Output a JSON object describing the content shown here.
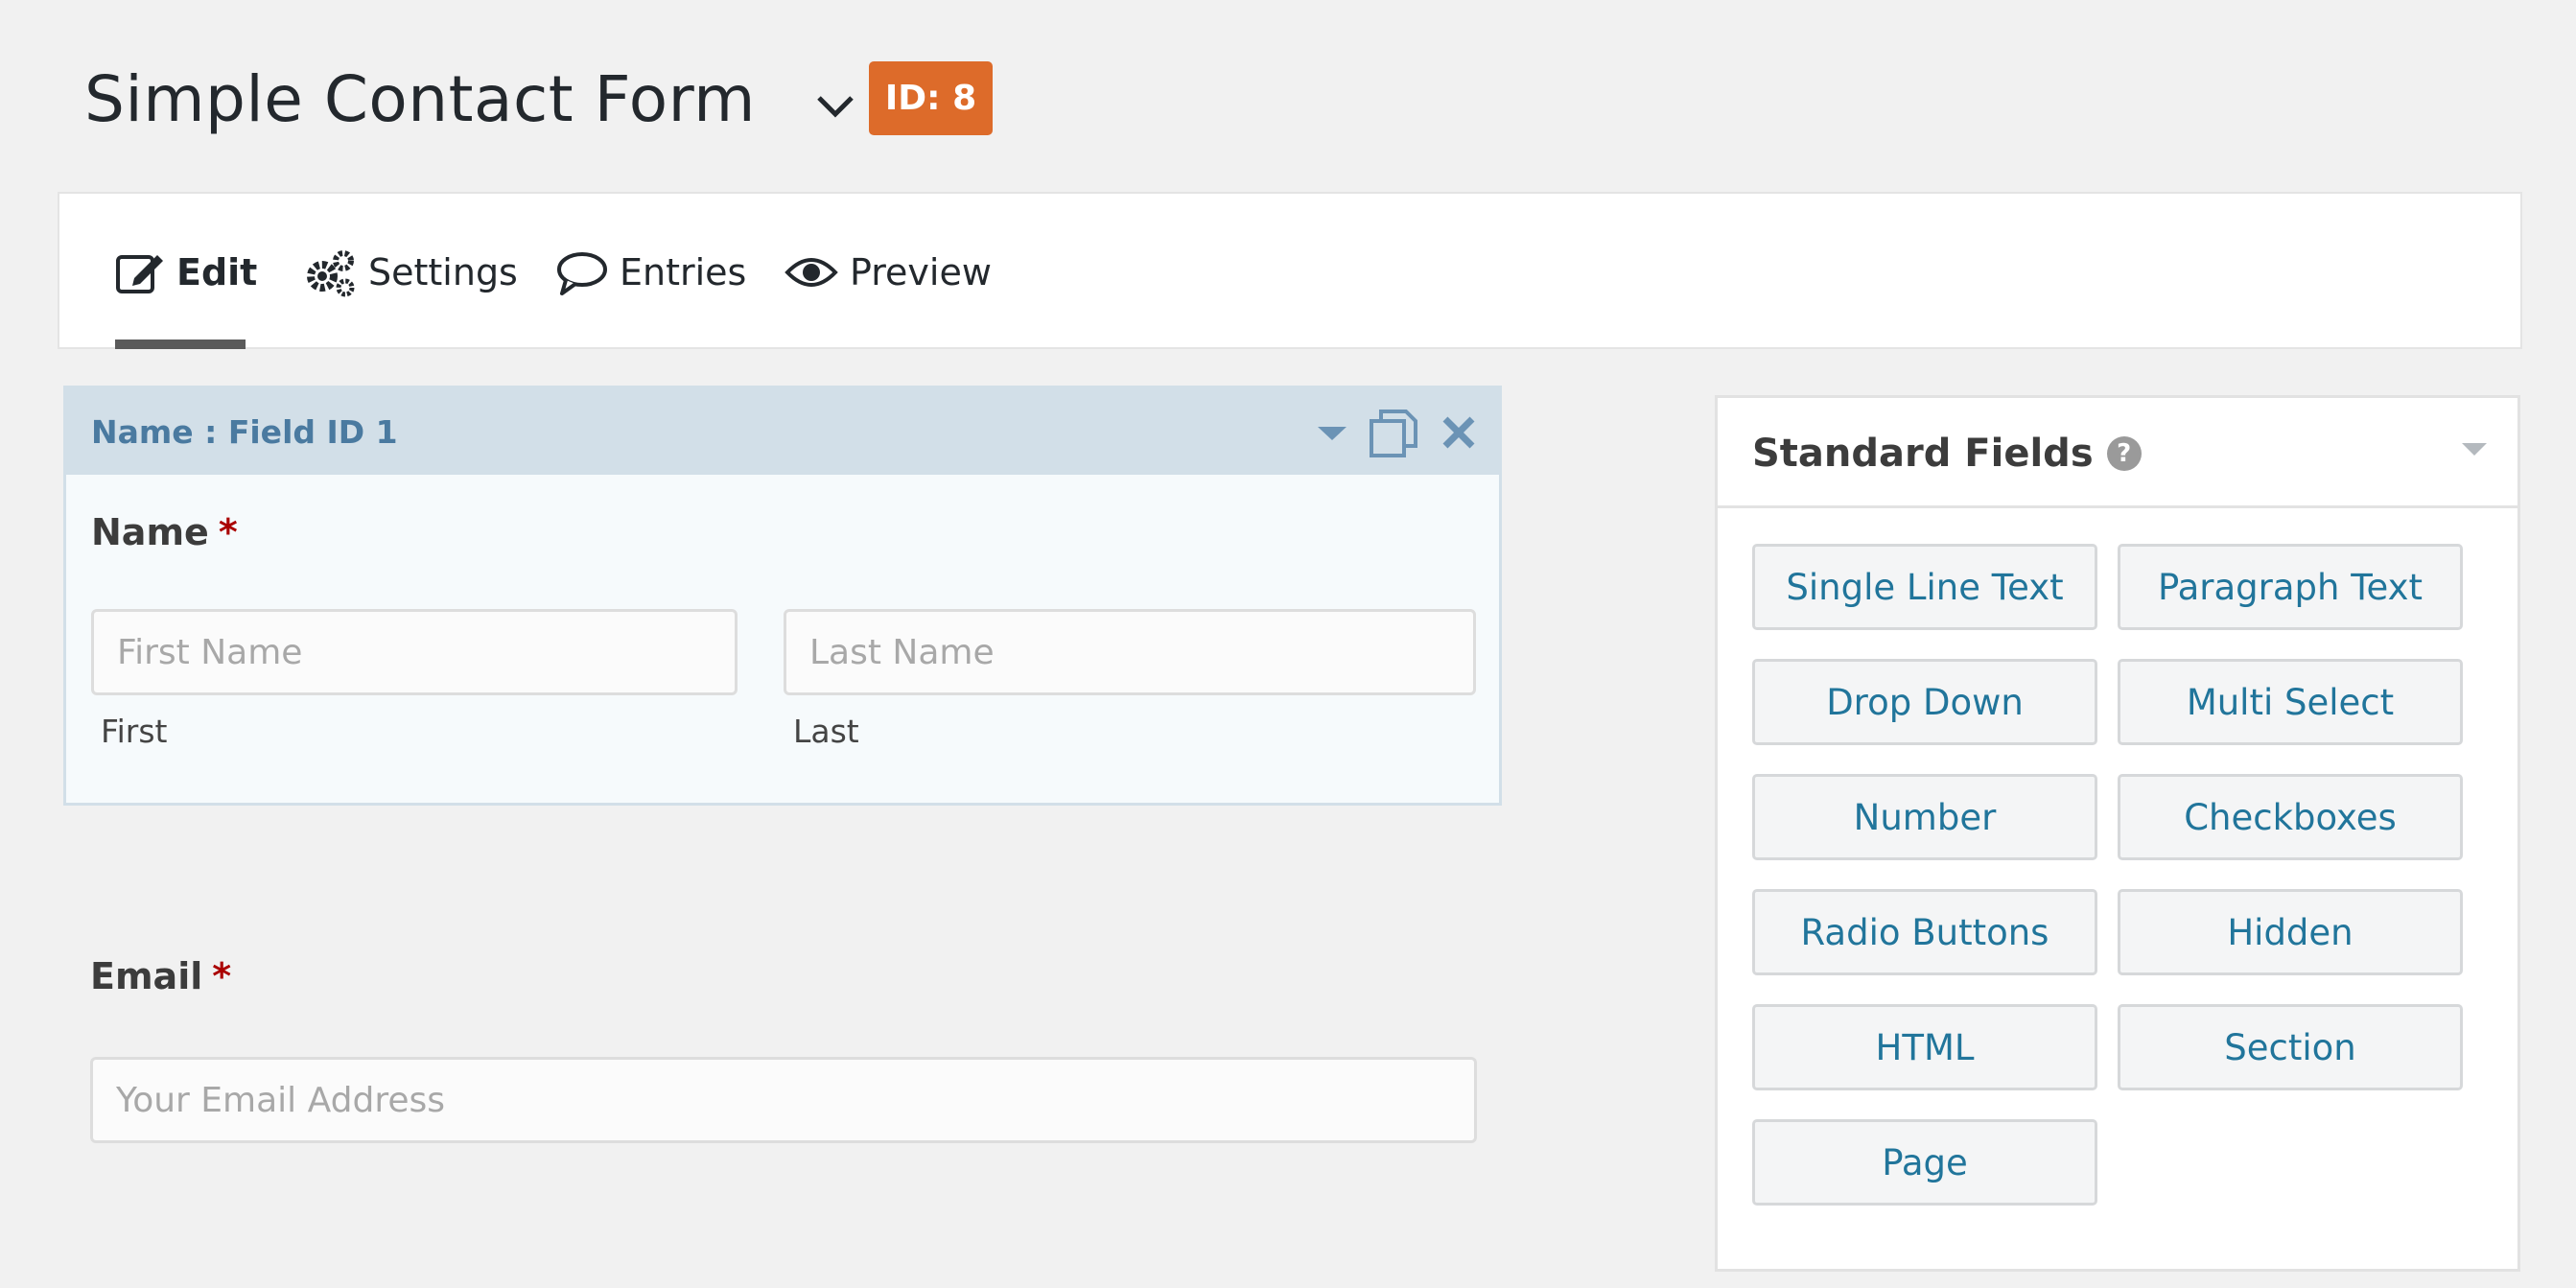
{
  "header": {
    "form_title": "Simple Contact Form",
    "id_badge": "ID: 8",
    "badge_color": "#dd6b2a"
  },
  "tabs": [
    {
      "label": "Edit",
      "icon": "edit-icon",
      "active": true
    },
    {
      "label": "Settings",
      "icon": "gears-icon",
      "active": false
    },
    {
      "label": "Entries",
      "icon": "speech-bubble-icon",
      "active": false
    },
    {
      "label": "Preview",
      "icon": "eye-icon",
      "active": false
    }
  ],
  "name_field": {
    "header": "Name : Field ID 1",
    "label": "Name",
    "required_mark": "*",
    "first_placeholder": "First Name",
    "last_placeholder": "Last Name",
    "first_sublabel": "First",
    "last_sublabel": "Last"
  },
  "email_field": {
    "label": "Email",
    "required_mark": "*",
    "placeholder": "Your Email Address"
  },
  "standard_fields": {
    "title": "Standard Fields",
    "help_glyph": "?",
    "buttons": [
      "Single Line Text",
      "Paragraph Text",
      "Drop Down",
      "Multi Select",
      "Number",
      "Checkboxes",
      "Radio Buttons",
      "Hidden",
      "HTML",
      "Section",
      "Page"
    ]
  },
  "colors": {
    "link_blue": "#21759b",
    "required_red": "#aa0000",
    "field_header_bg": "#d2dfe8"
  }
}
